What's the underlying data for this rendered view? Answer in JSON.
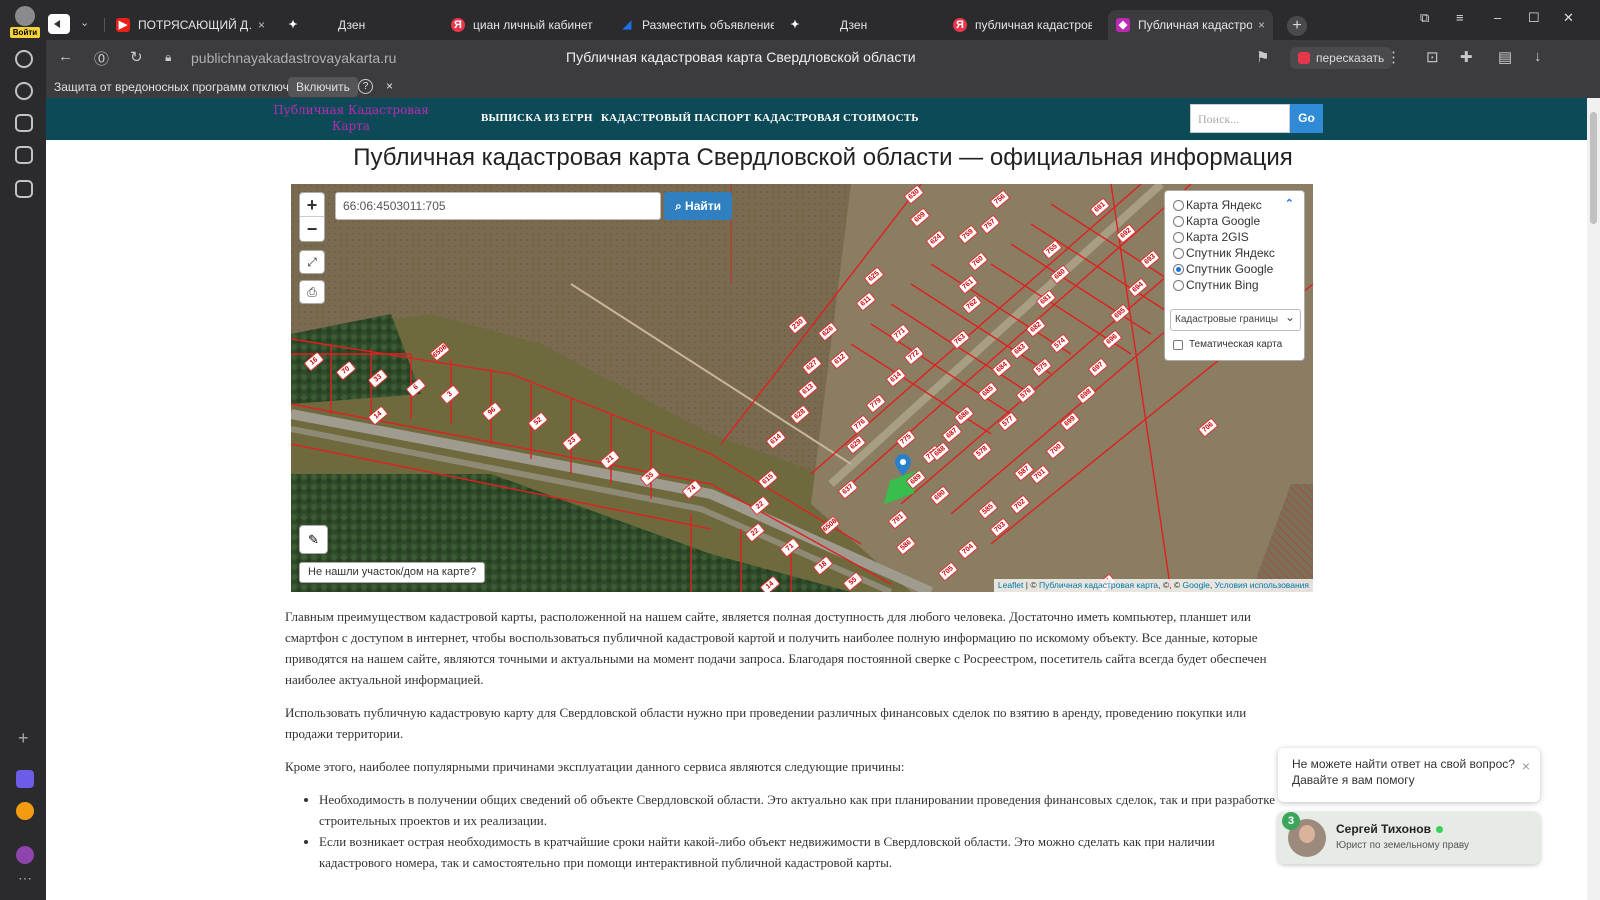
{
  "browser": {
    "login_label": "Войти",
    "tabs": [
      {
        "title": "ПОТРЯСАЮЩИЙ Д…",
        "favicon": "youtube-icon",
        "color": "#e62117"
      },
      {
        "title": "Дзен",
        "favicon": "zen-icon",
        "color": "#ffffff"
      },
      {
        "title": "циан личный кабинет вой…",
        "favicon": "yandex-icon",
        "color": "#e8364b"
      },
      {
        "title": "Разместить объявление о…",
        "favicon": "cian-icon",
        "color": "#1a73e8"
      },
      {
        "title": "Дзен",
        "favicon": "zen-icon",
        "color": "#ffffff"
      },
      {
        "title": "публичная кадастровая к…",
        "favicon": "yandex-icon",
        "color": "#e8364b"
      },
      {
        "title": "Публичная кадастрова…",
        "favicon": "site-icon",
        "color": "#b92bb3"
      }
    ],
    "url": "publichnayakadastrovayakarta.ru",
    "page_title": "Публичная кадастровая карта Свердловской области",
    "retell_label": "пересказать",
    "infobar": {
      "message": "Защита от вредоносных программ отключена",
      "enable_label": "Включить",
      "help_label": "?",
      "close_label": "×"
    }
  },
  "site": {
    "logo_text": "Публичная Кадастровая Карта",
    "nav": [
      "ВЫПИСКА ИЗ ЕГРН",
      "КАДАСТРОВЫЙ ПАСПОРТ",
      "КАДАСТРОВАЯ СТОИМОСТЬ"
    ],
    "search_placeholder": "Поиск...",
    "go_label": "Go",
    "heading": "Публичная кадастровая карта Свердловской области — официальная информация"
  },
  "map": {
    "zoom_in": "+",
    "zoom_out": "−",
    "cad_number": "66:06:4503011:705",
    "find_label": "Найти",
    "layers": [
      {
        "label": "Карта Яндекс",
        "selected": false
      },
      {
        "label": "Карта Google",
        "selected": false
      },
      {
        "label": "Карта 2GIS",
        "selected": false
      },
      {
        "label": "Спутник Яндекс",
        "selected": false
      },
      {
        "label": "Спутник Google",
        "selected": true
      },
      {
        "label": "Спутник Bing",
        "selected": false
      }
    ],
    "overlay_select": "Кадастровые границы",
    "thematic_label": "Тематическая карта",
    "not_found_label": "Не нашли участок/дом на карте?",
    "attribution": {
      "leaflet": "Leaflet",
      "sep1": " | © ",
      "site": "Публичная кадастровая карта",
      "sep2": ", ©, © ",
      "google": "Google",
      "sep3": ", ",
      "terms": "Условия использования"
    },
    "parcel_labels": [
      "16",
      "70",
      "33",
      "6",
      "3",
      "96",
      "52",
      "23",
      "21",
      "35",
      "74",
      "22",
      "22",
      "71",
      "18",
      "55",
      "14",
      "14",
      "6508",
      "6508",
      "230",
      "630",
      "609",
      "624",
      "625",
      "611",
      "626",
      "612",
      "627",
      "613",
      "628",
      "614",
      "629",
      "615",
      "637",
      "614",
      "779",
      "776",
      "775",
      "773",
      "771",
      "772",
      "763",
      "762",
      "761",
      "760",
      "759",
      "756",
      "757",
      "755",
      "680",
      "681",
      "682",
      "683",
      "684",
      "685",
      "686",
      "687",
      "688",
      "689",
      "690",
      "691",
      "692",
      "693",
      "694",
      "695",
      "696",
      "697",
      "698",
      "699",
      "700",
      "701",
      "702",
      "703",
      "704",
      "705",
      "706",
      "791",
      "791",
      "586",
      "585",
      "587",
      "578",
      "577",
      "576",
      "575",
      "574"
    ]
  },
  "content": {
    "paragraphs": [
      "Главным преимуществом кадастровой карты, расположенной на нашем сайте, является полная доступность для любого человека. Достаточно иметь компьютер, планшет или смартфон с доступом в интернет, чтобы воспользоваться публичной кадастровой картой и получить наиболее полную информацию по искомому объекту. Все данные, которые приводятся на нашем сайте, являются точными и актуальными на момент подачи запроса. Благодаря постоянной сверке с Росреестром, посетитель сайта всегда будет обеспечен наиболее актуальной информацией.",
      "Использовать публичную кадастровую карту для Свердловской области нужно при проведении различных финансовых сделок по взятию в аренду, проведению покупки или продажи территории.",
      "Кроме этого, наиболее популярными причинами эксплуатации данного сервиса являются следующие причины:"
    ],
    "list": [
      "Необходимость в получении общих сведений об объекте Свердловской области. Это актуально как при планировании проведения финансовых сделок, так и при разработке строительных проектов и их реализации.",
      "Если возникает острая необходимость в кратчайшие сроки найти какой-либо объект недвижимости в Свердловской области. Это можно сделать как при наличии кадастрового номера, так и самостоятельно при помощи интерактивной публичной кадастровой карты."
    ]
  },
  "chat": {
    "question": "Не можете найти ответ на свой вопрос? Давайте я вам помогу",
    "close_label": "×",
    "badge_count": "3",
    "agent_name": "Сергей Тихонов",
    "agent_role": "Юрист по земельному праву"
  }
}
